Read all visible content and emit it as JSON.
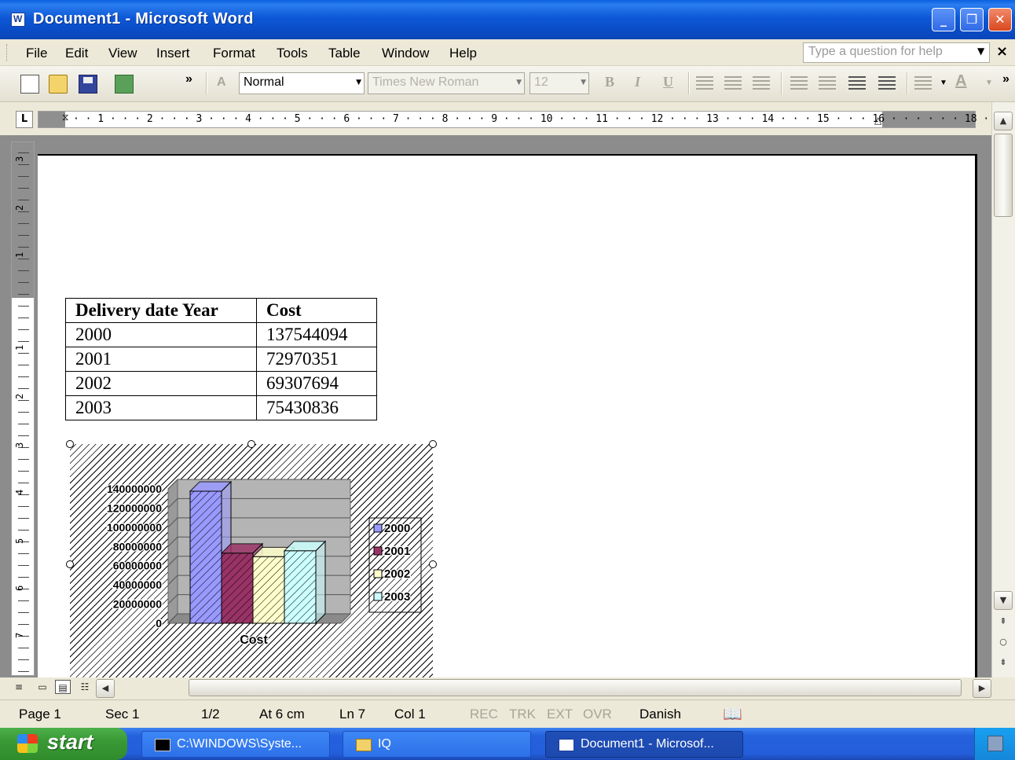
{
  "window": {
    "title": "Document1 - Microsoft Word"
  },
  "menu": {
    "items": [
      "File",
      "Edit",
      "View",
      "Insert",
      "Format",
      "Tools",
      "Table",
      "Window",
      "Help"
    ],
    "help_placeholder": "Type a question for help"
  },
  "toolbar": {
    "chevron": "»",
    "style_value": "Normal",
    "font_value": "Times New Roman",
    "size_value": "12",
    "bold": "B",
    "italic": "I",
    "underline": "U"
  },
  "ruler": {
    "tab_selector": "L",
    "horizontal_labels": "· · 1 · · · 2 · · · 3 · · · 4 · · · 5 · · · 6 · · · 7 · · · 8 · · · 9 · · · 10 · · · 11 · · · 12 · · · 13 · · · 14 · · · 15 · · · 16 · · · · · · 18 · ·",
    "vertical_labels": [
      "3",
      "2",
      "1",
      "1",
      "2",
      "3",
      "4",
      "5",
      "6",
      "7"
    ]
  },
  "table": {
    "headers": [
      "Delivery date Year",
      "Cost"
    ],
    "rows": [
      [
        "2000",
        "137544094"
      ],
      [
        "2001",
        "72970351"
      ],
      [
        "2002",
        "69307694"
      ],
      [
        "2003",
        "75430836"
      ]
    ]
  },
  "chart_data": {
    "type": "bar",
    "categories": [
      "Cost"
    ],
    "series": [
      {
        "name": "2000",
        "values": [
          137544094
        ],
        "color": "#9999ff"
      },
      {
        "name": "2001",
        "values": [
          72970351
        ],
        "color": "#993366"
      },
      {
        "name": "2002",
        "values": [
          69307694
        ],
        "color": "#ffffcc"
      },
      {
        "name": "2003",
        "values": [
          75430836
        ],
        "color": "#ccffff"
      }
    ],
    "ylim": [
      0,
      140000000
    ],
    "yticks": [
      "140000000",
      "120000000",
      "100000000",
      "80000000",
      "60000000",
      "40000000",
      "20000000",
      "0"
    ],
    "xlabel": "Cost",
    "legend": "right",
    "three_d": true,
    "grid": true
  },
  "status": {
    "page": "Page 1",
    "sec": "Sec 1",
    "pages": "1/2",
    "at": "At 6 cm",
    "ln": "Ln 7",
    "col": "Col 1",
    "rec": "REC",
    "trk": "TRK",
    "ext": "EXT",
    "ovr": "OVR",
    "language": "Danish"
  },
  "taskbar": {
    "start": "start",
    "items": [
      "C:\\WINDOWS\\Syste...",
      "IQ",
      "Document1 - Microsof..."
    ]
  },
  "colors": {
    "title_bar": "#0a4bc4",
    "taskbar": "#245edb",
    "start_button": "#3a9a36"
  }
}
